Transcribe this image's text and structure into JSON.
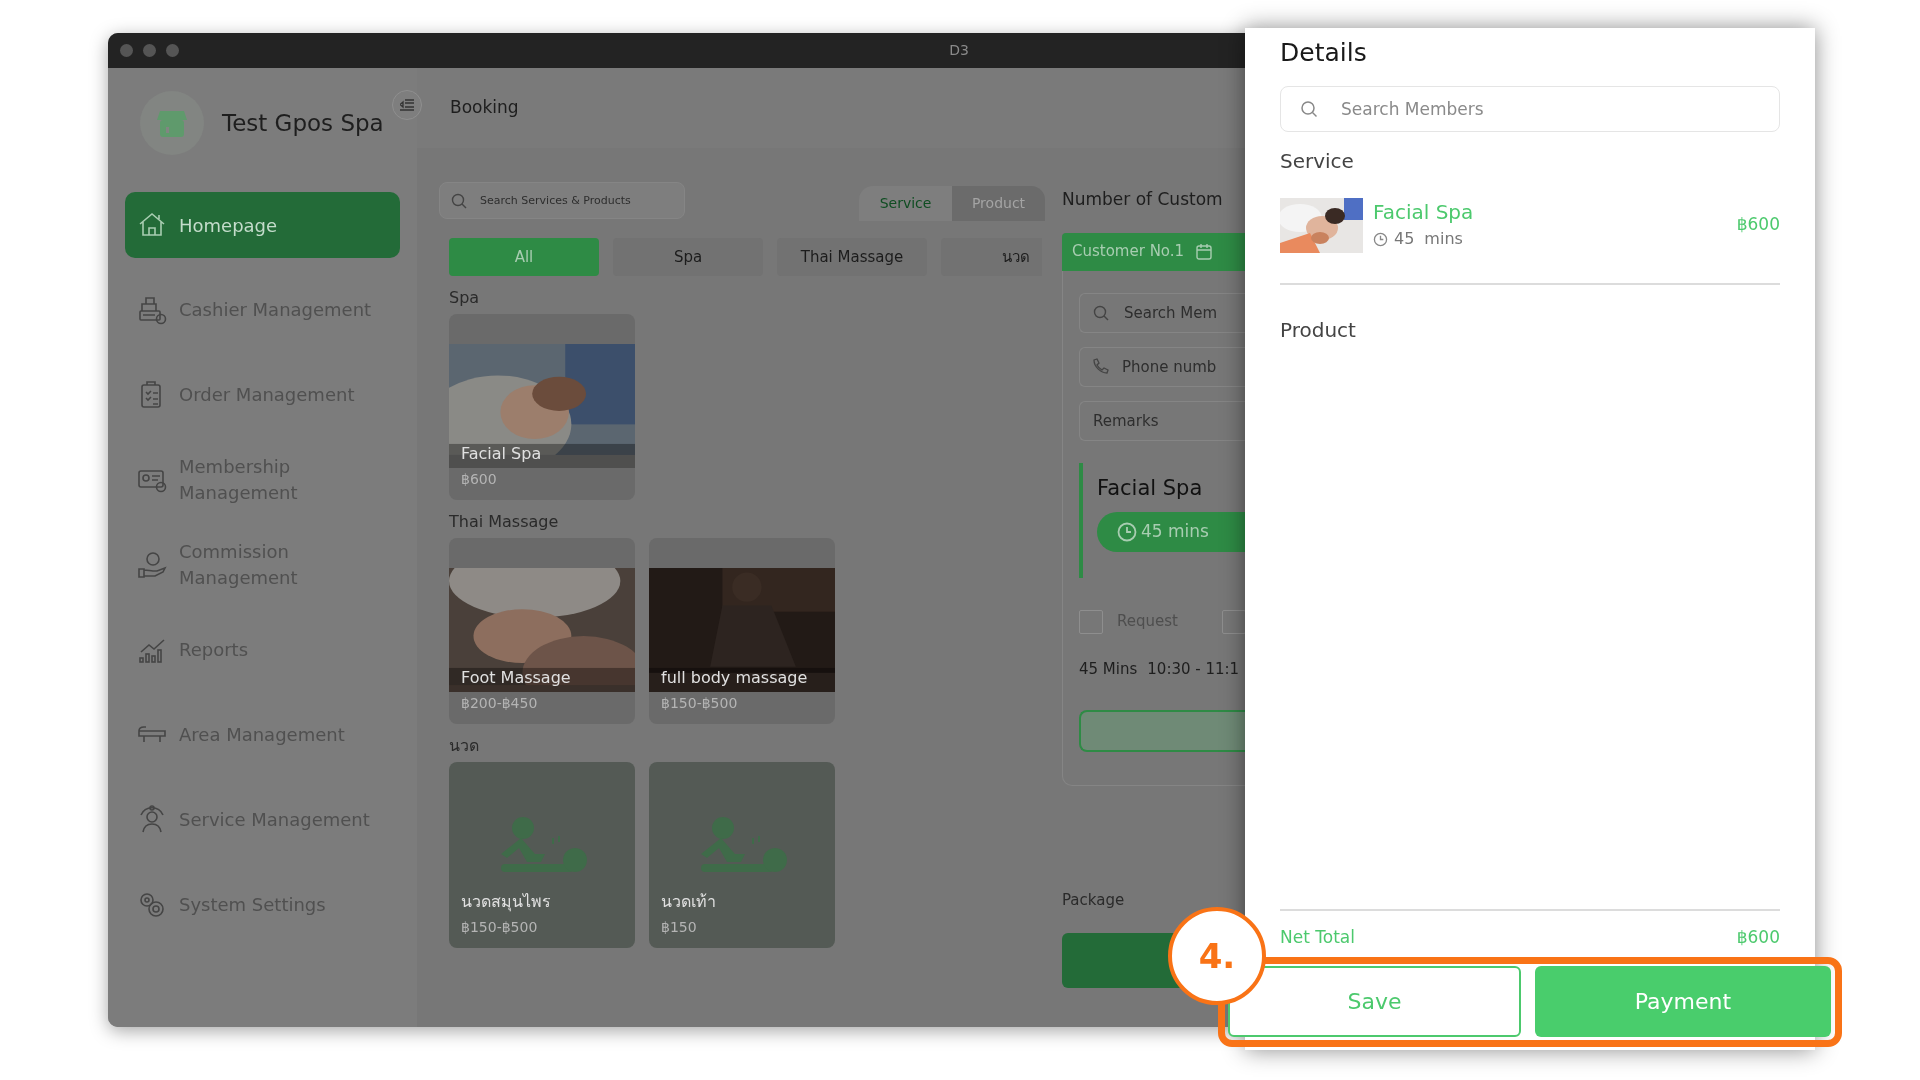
{
  "window": {
    "title": "D3"
  },
  "sidebar": {
    "brand": "Test Gpos Spa",
    "items": [
      {
        "label": "Homepage",
        "selected": true
      },
      {
        "label": "Cashier Management",
        "selected": false
      },
      {
        "label": "Order Management",
        "selected": false
      },
      {
        "label": "Membership Management",
        "selected": false
      },
      {
        "label": "Commission Management",
        "selected": false
      },
      {
        "label": "Reports",
        "selected": false
      },
      {
        "label": "Area Management",
        "selected": false
      },
      {
        "label": "Service Management",
        "selected": false
      },
      {
        "label": "System Settings",
        "selected": false
      }
    ]
  },
  "header": {
    "title": "Booking"
  },
  "catalog": {
    "search": {
      "placeholder": "Search Services & Products"
    },
    "mode_tabs": [
      {
        "label": "Service",
        "selected": true
      },
      {
        "label": "Product",
        "selected": false
      }
    ],
    "categories": [
      {
        "label": "All",
        "selected": true
      },
      {
        "label": "Spa",
        "selected": false
      },
      {
        "label": "Thai Massage",
        "selected": false
      },
      {
        "label": "นวด",
        "selected": false
      }
    ],
    "sections": [
      {
        "title": "Spa",
        "items": [
          {
            "name": "Facial Spa",
            "price": "฿600",
            "kind": "picture"
          }
        ]
      },
      {
        "title": "Thai Massage",
        "items": [
          {
            "name": "Foot Massage",
            "price": "฿200-฿450",
            "kind": "picture"
          },
          {
            "name": "full body massage",
            "price": "฿150-฿500",
            "kind": "picture"
          }
        ]
      },
      {
        "title": "นวด",
        "items": [
          {
            "name": "นวดสมุนไพร",
            "price": "฿150-฿500",
            "kind": "placeholder"
          },
          {
            "name": "นวดเท้า",
            "price": "฿150",
            "kind": "placeholder"
          }
        ]
      }
    ]
  },
  "customer": {
    "heading": "Number of Custom",
    "tab": "Customer No.1",
    "search": {
      "placeholder": "Search Mem"
    },
    "phone": {
      "placeholder": "Phone numb"
    },
    "remarks": {
      "placeholder": "Remarks"
    },
    "service": {
      "name": "Facial Spa",
      "duration": "45 mins"
    },
    "checkboxes": [
      {
        "label": "Request",
        "checked": false
      },
      {
        "checked": false
      }
    ],
    "duration": "45 Mins",
    "time": "10:30 - 11:1",
    "package_label": "Package"
  },
  "details": {
    "title": "Details",
    "search": {
      "placeholder": "Search Members"
    },
    "service_heading": "Service",
    "services": [
      {
        "name": "Facial Spa",
        "duration": "45",
        "unit": "mins",
        "price": "฿600"
      }
    ],
    "product_heading": "Product",
    "net_total": {
      "label": "Net Total",
      "value": "฿600"
    },
    "buttons": [
      {
        "label": "Save",
        "kind": "outline"
      },
      {
        "label": "Payment",
        "kind": "primary"
      }
    ]
  },
  "callout": {
    "step": "4."
  }
}
